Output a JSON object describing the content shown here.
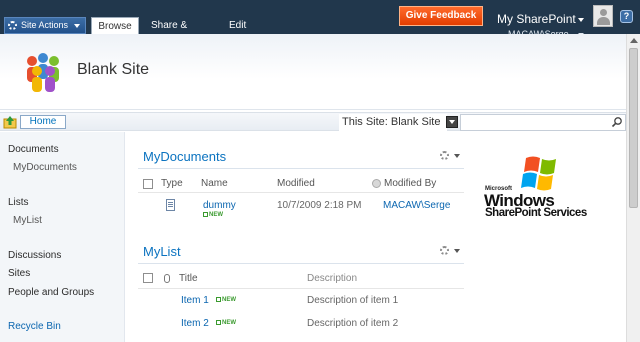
{
  "ribbon": {
    "site_actions_label": "Site Actions",
    "tabs": [
      {
        "label": "Browse",
        "active": true
      },
      {
        "label": "Share & Track",
        "active": false
      },
      {
        "label": "Edit",
        "active": false
      }
    ],
    "feedback_label": "Give Feedback",
    "my_sharepoint_label": "My SharePoint",
    "user_name": "MACAW\\Serge",
    "help_label": "?"
  },
  "header": {
    "site_title": "Blank Site"
  },
  "topnav": {
    "home_label": "Home",
    "search_scope": "This Site: Blank Site",
    "search_placeholder": ""
  },
  "leftnav": {
    "documents_heading": "Documents",
    "documents_items": [
      "MyDocuments"
    ],
    "lists_heading": "Lists",
    "lists_items": [
      "MyList"
    ],
    "discussions": "Discussions",
    "sites": "Sites",
    "people_and_groups": "People and Groups",
    "recycle_bin": "Recycle Bin"
  },
  "mydocuments": {
    "title": "MyDocuments",
    "columns": [
      "Type",
      "Name",
      "Modified",
      "Modified By"
    ],
    "rows": [
      {
        "name": "dummy",
        "modified": "10/7/2009 2:18 PM",
        "modified_by": "MACAW\\Serge",
        "new_label": "NEW"
      }
    ]
  },
  "mylist": {
    "title": "MyList",
    "columns": [
      "Title",
      "Description"
    ],
    "rows": [
      {
        "title": "Item 1",
        "description": "Description of item 1",
        "new_label": "NEW"
      },
      {
        "title": "Item 2",
        "description": "Description of item 2",
        "new_label": "NEW"
      }
    ]
  },
  "product_logo": {
    "brand": "Microsoft",
    "line1": "Windows",
    "line2": "SharePoint Services"
  },
  "colors": {
    "ribbon_bg": "#21374c",
    "feedback_bg": "#e84f0d",
    "link": "#0b66b0",
    "webpart_title": "#0b73c0"
  }
}
